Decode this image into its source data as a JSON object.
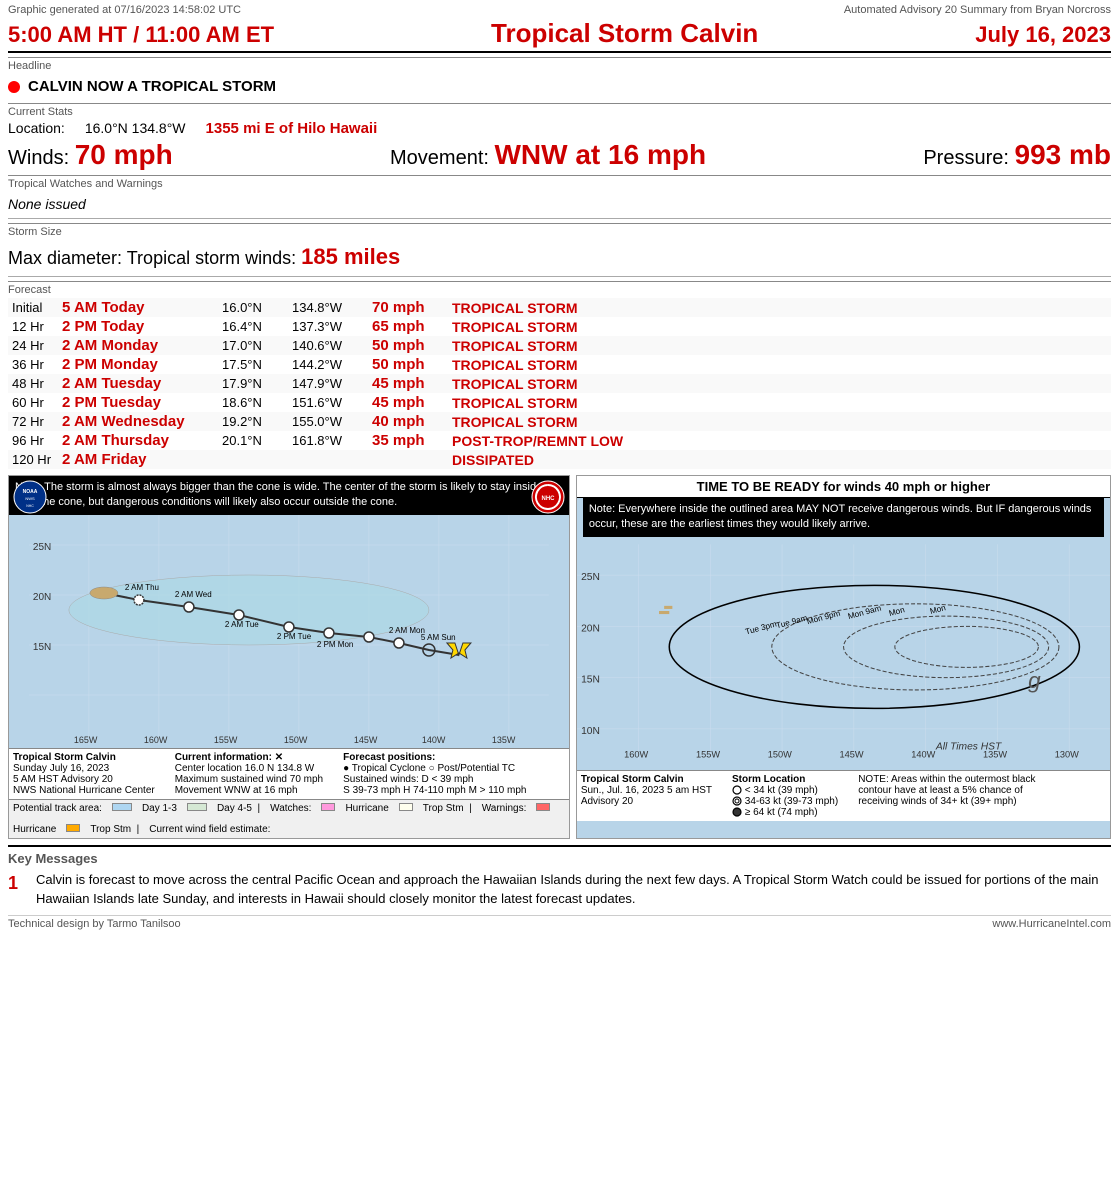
{
  "meta": {
    "generated": "Graphic generated at 07/16/2023 14:58:02 UTC",
    "advisory": "Automated Advisory 20 Summary from Bryan Norcross"
  },
  "header": {
    "time": "5:00 AM HT / 11:00 AM ET",
    "title": "Tropical Storm Calvin",
    "date": "July 16, 2023"
  },
  "headline_label": "Headline",
  "headline": "CALVIN NOW A TROPICAL STORM",
  "stats_label": "Current Stats",
  "location": {
    "label": "Location:",
    "coords": "16.0°N 134.8°W",
    "description": "1355 mi E of Hilo Hawaii"
  },
  "winds": {
    "label": "Winds:",
    "value": "70 mph"
  },
  "movement": {
    "label": "Movement:",
    "value": "WNW at 16 mph"
  },
  "pressure": {
    "label": "Pressure:",
    "value": "993 mb"
  },
  "watches_label": "Tropical Watches and Warnings",
  "watches_text": "None issued",
  "storm_size_label": "Storm Size",
  "storm_size": {
    "label": "Max diameter:",
    "desc": "Tropical storm winds:",
    "value": "185 miles"
  },
  "forecast_label": "Forecast",
  "forecast": [
    {
      "hour": "Initial",
      "time": "5 AM Today",
      "lat": "16.0°N",
      "lon": "134.8°W",
      "wind": "70 mph",
      "type": "TROPICAL STORM"
    },
    {
      "hour": "12 Hr",
      "time": "2 PM Today",
      "lat": "16.4°N",
      "lon": "137.3°W",
      "wind": "65 mph",
      "type": "TROPICAL STORM"
    },
    {
      "hour": "24 Hr",
      "time": "2 AM Monday",
      "lat": "17.0°N",
      "lon": "140.6°W",
      "wind": "50 mph",
      "type": "TROPICAL STORM"
    },
    {
      "hour": "36 Hr",
      "time": "2 PM Monday",
      "lat": "17.5°N",
      "lon": "144.2°W",
      "wind": "50 mph",
      "type": "TROPICAL STORM"
    },
    {
      "hour": "48 Hr",
      "time": "2 AM Tuesday",
      "lat": "17.9°N",
      "lon": "147.9°W",
      "wind": "45 mph",
      "type": "TROPICAL STORM"
    },
    {
      "hour": "60 Hr",
      "time": "2 PM Tuesday",
      "lat": "18.6°N",
      "lon": "151.6°W",
      "wind": "45 mph",
      "type": "TROPICAL STORM"
    },
    {
      "hour": "72 Hr",
      "time": "2 AM Wednesday",
      "lat": "19.2°N",
      "lon": "155.0°W",
      "wind": "40 mph",
      "type": "TROPICAL STORM"
    },
    {
      "hour": "96 Hr",
      "time": "2 AM Thursday",
      "lat": "20.1°N",
      "lon": "161.8°W",
      "wind": "35 mph",
      "type": "POST-TROP/REMNT LOW"
    },
    {
      "hour": "120 Hr",
      "time": "2 AM Friday",
      "lat": "",
      "lon": "",
      "wind": "",
      "type": "DISSIPATED"
    }
  ],
  "map_left": {
    "note": "Note: The storm is almost always bigger than the cone is wide. The center of the storm is likely to stay inside or near the cone, but dangerous conditions will likely also occur outside the cone.",
    "title": "Tropical Storm Calvin",
    "date_line": "Sunday July 16, 2023",
    "advisory": "5 AM HST Advisory 20",
    "center_label": "NWS National Hurricane Center",
    "info_label": "Current information: ✕",
    "location_info": "Center location 16.0 N 134.8 W",
    "wind_info": "Maximum sustained wind 70 mph",
    "movement_info": "Movement WNW at 16 mph",
    "forecast_label": "Forecast positions:",
    "legend1": "● Tropical Cyclone  ○ Post/Potential TC",
    "legend2": "Sustained winds:   D < 39 mph",
    "legend3": "S 39-73 mph  H 74-110 mph  M > 110 mph",
    "track_label": "Potential track area:",
    "watches_label": "Watches:",
    "warnings_label": "Warnings:",
    "wind_field_label": "Current wind field estimate:",
    "legend_items": [
      "Day 1-3",
      "Day 4-5",
      "Hurricane",
      "Trop Stm",
      "Hurricane",
      "Trop Stm",
      "Hurricane",
      "Trop Stm"
    ]
  },
  "map_right": {
    "title": "TIME TO BE READY for winds 40 mph or higher",
    "note": "Note: Everywhere inside the outlined area MAY NOT receive dangerous winds. But IF dangerous winds occur, these are the earliest times they would likely arrive.",
    "storm_name": "Tropical Storm Calvin",
    "date_line": "Sun., Jul. 16, 2023  5 am HST",
    "advisory": "Advisory 20",
    "storm_loc_label": "Storm Location",
    "speed1": "< 34 kt (39 mph)",
    "speed2": "34-63 kt (39-73 mph)",
    "speed3": "≥ 64 kt (74 mph)",
    "note2": "NOTE: Areas within the outermost black contour have at least a 5% chance of receiving winds of 34+ kt (39+ mph)",
    "times_label": "All Times HST"
  },
  "key_messages_label": "Key Messages",
  "key_messages": [
    {
      "number": "1",
      "text": "Calvin is forecast to move across the central Pacific Ocean and approach the Hawaiian Islands during the next few days. A Tropical Storm Watch could be issued for portions of the main Hawaiian Islands late Sunday, and interests in Hawaii should closely monitor the latest forecast updates."
    }
  ],
  "footer": {
    "left": "Technical design by Tarmo Tanilsoo",
    "right": "www.HurricaneIntel.com"
  }
}
